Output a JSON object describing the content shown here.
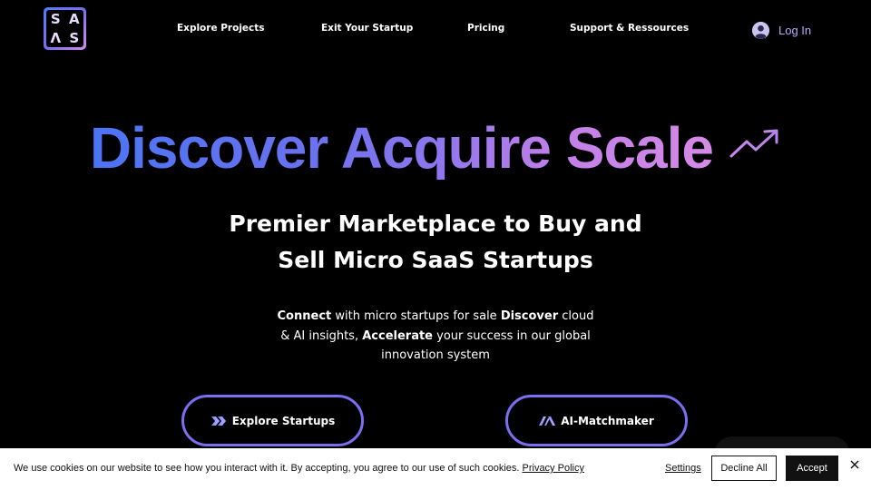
{
  "logo": {
    "letters": [
      "S",
      "A",
      "Λ",
      "S"
    ]
  },
  "nav": {
    "items": [
      {
        "label": "Explore Projects"
      },
      {
        "label": "Exit Your Startup"
      },
      {
        "label": "Pricing"
      },
      {
        "label": "Support & Ressources"
      }
    ],
    "login_label": "Log In"
  },
  "hero": {
    "title": "Discover Acquire Scale",
    "subtitle_line1": "Premier Marketplace to Buy and",
    "subtitle_line2": "Sell Micro SaaS Startups",
    "desc": {
      "b1": "Connect",
      "t1": " with micro startups for sale ",
      "b2": "Discover",
      "t2": " cloud",
      "t3": "& AI insights, ",
      "b3": "Accelerate",
      "t4": " your success in our global",
      "t5": "innovation system"
    }
  },
  "buttons": {
    "explore_label": "Explore Startups",
    "matchmaker_label": "AI-Matchmaker"
  },
  "cookie": {
    "text": "We use cookies on our website to see how you interact with it. By accepting, you agree to our use of such cookies.",
    "policy_link": "Privacy Policy",
    "settings": "Settings",
    "decline": "Decline All",
    "accept": "Accept"
  },
  "colors": {
    "accent": "#7b6ef0",
    "gradient_start": "#4a74f5",
    "gradient_end": "#d58be6",
    "login_text": "#b4a9ff"
  }
}
